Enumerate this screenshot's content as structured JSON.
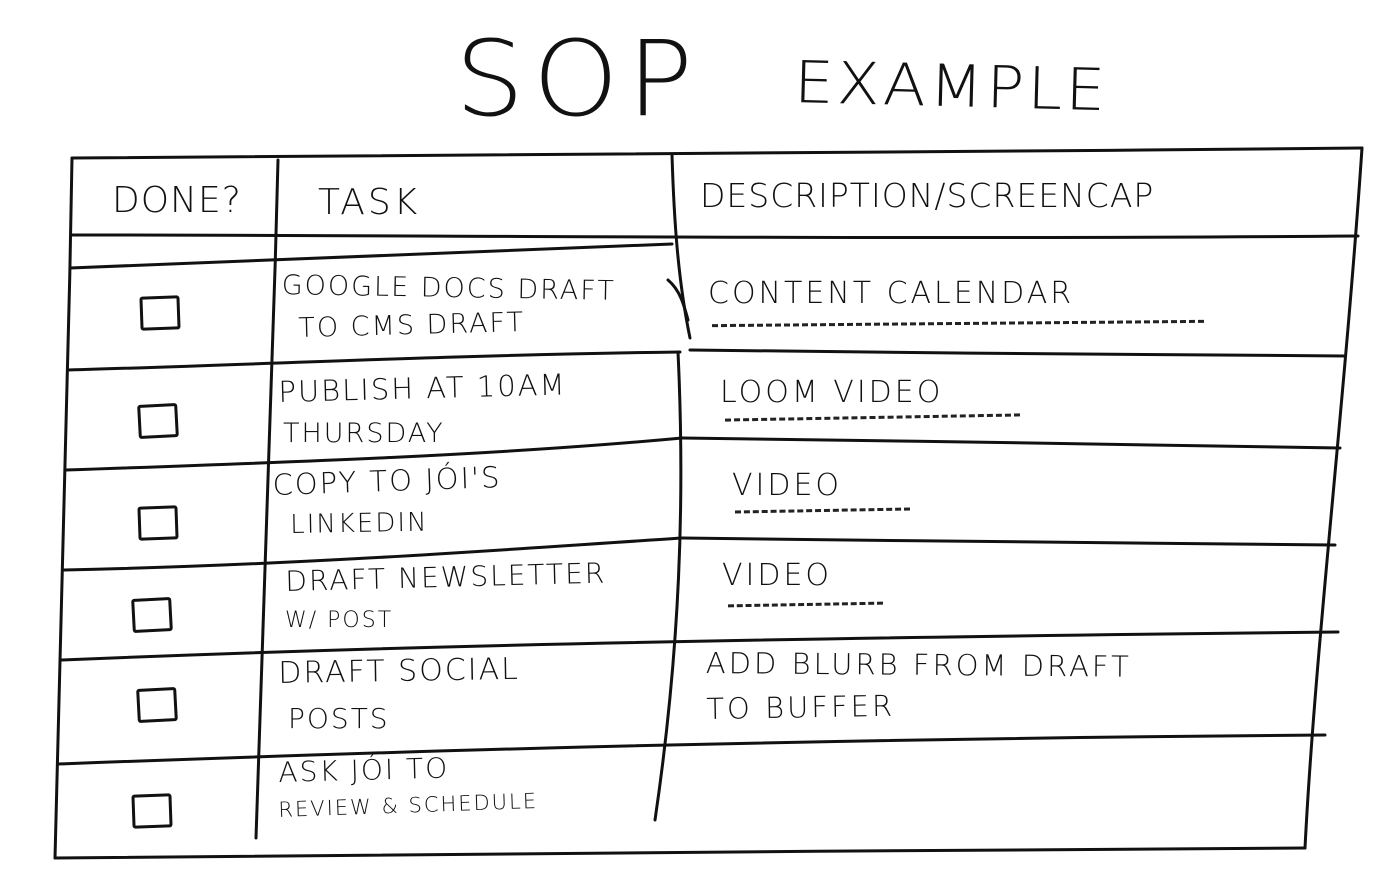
{
  "title": {
    "main": "SOP",
    "sub": "Example"
  },
  "table": {
    "headers": {
      "done": "Done?",
      "task": "Task",
      "description": "Description/Screencap"
    },
    "rows": [
      {
        "done": false,
        "task_line1": "Google Docs draft",
        "task_line2": "to CMS draft",
        "description_line1": "Content calendar",
        "description_line2": "",
        "description_is_link": true
      },
      {
        "done": false,
        "task_line1": "Publish at 10AM",
        "task_line2": "Thursday",
        "description_line1": "Loom video",
        "description_line2": "",
        "description_is_link": true
      },
      {
        "done": false,
        "task_line1": "Copy to Jói's",
        "task_line2": "LinkedIn",
        "description_line1": "Video",
        "description_line2": "",
        "description_is_link": true
      },
      {
        "done": false,
        "task_line1": "Draft newsletter",
        "task_line2": "w/ post",
        "description_line1": "Video",
        "description_line2": "",
        "description_is_link": true
      },
      {
        "done": false,
        "task_line1": "Draft social",
        "task_line2": "posts",
        "description_line1": "Add blurb from draft",
        "description_line2": "to Buffer",
        "description_is_link": false
      },
      {
        "done": false,
        "task_line1": "Ask Jói to",
        "task_line2": "review & schedule",
        "description_line1": "",
        "description_line2": "",
        "description_is_link": false
      }
    ]
  }
}
